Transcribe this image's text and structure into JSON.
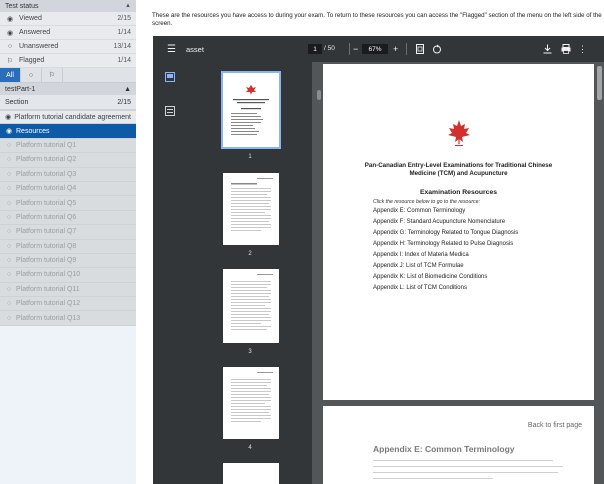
{
  "sidebar": {
    "test_status": {
      "title": "Test status"
    },
    "statuses": [
      {
        "icon": "eye-icon",
        "label": "Viewed",
        "count": "2/15"
      },
      {
        "icon": "check-circle-icon",
        "label": "Answered",
        "count": "1/14"
      },
      {
        "icon": "empty-circle-icon",
        "label": "Unanswered",
        "count": "13/14"
      },
      {
        "icon": "flag-icon",
        "label": "Flagged",
        "count": "1/14"
      }
    ],
    "filters": [
      {
        "label": "All",
        "active": true
      },
      {
        "label": "○",
        "active": false
      },
      {
        "label": "⚐",
        "active": false
      }
    ],
    "part": {
      "title": "testPart-1"
    },
    "section": {
      "label": "Section",
      "count": "2/15"
    },
    "items": [
      {
        "label": "Platform tutorial candidate agreement",
        "state": "viewed"
      },
      {
        "label": "Resources",
        "state": "active"
      },
      {
        "label": "Platform tutorial Q1",
        "state": "unviewed"
      },
      {
        "label": "Platform tutorial Q2",
        "state": "unviewed"
      },
      {
        "label": "Platform tutorial Q3",
        "state": "unviewed"
      },
      {
        "label": "Platform tutorial Q4",
        "state": "unviewed"
      },
      {
        "label": "Platform tutorial Q5",
        "state": "unviewed"
      },
      {
        "label": "Platform tutorial Q6",
        "state": "unviewed"
      },
      {
        "label": "Platform tutorial Q7",
        "state": "unviewed"
      },
      {
        "label": "Platform tutorial Q8",
        "state": "unviewed"
      },
      {
        "label": "Platform tutorial Q9",
        "state": "unviewed"
      },
      {
        "label": "Platform tutorial Q10",
        "state": "unviewed"
      },
      {
        "label": "Platform tutorial Q11",
        "state": "unviewed"
      },
      {
        "label": "Platform tutorial Q12",
        "state": "unviewed"
      },
      {
        "label": "Platform tutorial Q13",
        "state": "unviewed"
      }
    ]
  },
  "main": {
    "intro": "These are the resources you have access to during your exam. To return to these resources you can access the \"Flagged\" section of the menu on the left side of the screen."
  },
  "viewer": {
    "title": "asset",
    "page_current": "1",
    "page_total": "/ 50",
    "zoom": "67%",
    "thumb_labels": [
      "1",
      "2",
      "3",
      "4"
    ],
    "page1": {
      "heading": "Pan-Canadian Entry-Level Examinations for Traditional Chinese Medicine (TCM) and Acupuncture",
      "section_title": "Examination Resources",
      "click_note": "Click the resource below to go to the resource:",
      "links": [
        "Appendix E: Common Terminology",
        "Appendix F: Standard Acupuncture Nomenclature",
        "Appendix G: Terminology Related to Tongue Diagnosis",
        "Appendix H: Terminology Related to Pulse Diagnosis",
        "Appendix I: Index of Materia Medica",
        "Appendix J: List of TCM Formulae",
        "Appendix K: List of Biomedicine Conditions",
        "Appendix L: List of TCM Conditions"
      ]
    },
    "page2": {
      "back_link": "Back to first page",
      "heading": "Appendix E: Common Terminology"
    }
  },
  "colors": {
    "accent": "#0f5aa6",
    "viewer_bg": "#525659",
    "toolbar": "#323639",
    "leaf_red": "#d32f2f"
  }
}
